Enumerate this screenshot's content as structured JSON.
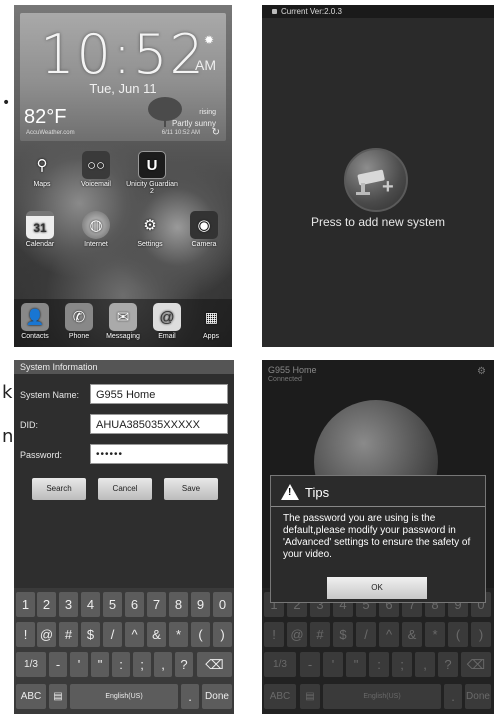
{
  "panel1": {
    "clock_time": "10:52",
    "ampm": "AM",
    "date": "Tue, Jun 11",
    "temperature": "82°F",
    "weather_brand": "AccuWeather.com",
    "weather_rising": "rising",
    "weather_desc": "Partly sunny",
    "weather_updated": "6/11 10:52 AM",
    "calendar_day": "31",
    "apps_row1": [
      "Maps",
      "Voicemail",
      "Unicity Guardian 2"
    ],
    "apps_row2": [
      "Calendar",
      "Internet",
      "Settings",
      "Camera"
    ],
    "dock": [
      "Contacts",
      "Phone",
      "Messaging",
      "Email",
      "Apps"
    ]
  },
  "panel2": {
    "status": "Current Ver:2.0.3",
    "add_label": "Press to add new system"
  },
  "panel3": {
    "title": "System Information",
    "labels": {
      "name": "System Name:",
      "did": "DID:",
      "password": "Password:"
    },
    "values": {
      "name": "G955 Home",
      "did": "AHUA385035XXXXX",
      "password": "••••••"
    },
    "buttons": {
      "search": "Search",
      "cancel": "Cancel",
      "save": "Save"
    },
    "keys_row1": [
      "1",
      "2",
      "3",
      "4",
      "5",
      "6",
      "7",
      "8",
      "9",
      "0"
    ],
    "keys_row2": [
      "!",
      "@",
      "#",
      "$",
      "/",
      "^",
      "&",
      "*",
      "(",
      ")"
    ],
    "keys_row3": [
      "1/3",
      "-",
      "'",
      "\"",
      ":",
      ";",
      ",",
      "?",
      "⌫"
    ],
    "keys_row4": {
      "abc": "ABC",
      "space": "English(US)",
      "dot": ".",
      "done": "Done"
    }
  },
  "panel4": {
    "header": "G955 Home",
    "sub": "Connected",
    "tips_title": "Tips",
    "tips_body": "The password you are using is the default,please modify your password in 'Advanced' settings to ensure the safety of your video.",
    "ok": "OK"
  },
  "edge_text": {
    "k": "k",
    "n": "n"
  }
}
